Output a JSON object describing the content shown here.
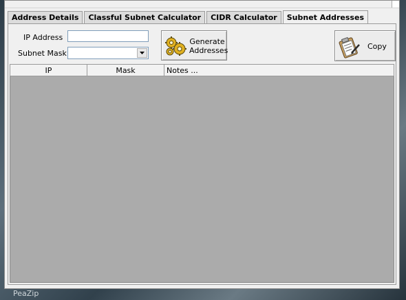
{
  "desktop": {
    "taskbar_text": "PeaZip"
  },
  "tabs": [
    {
      "label": "Address Details",
      "active": false
    },
    {
      "label": "Classful Subnet Calculator",
      "active": false
    },
    {
      "label": "CIDR Calculator",
      "active": false
    },
    {
      "label": "Subnet Addresses",
      "active": true
    }
  ],
  "form": {
    "ip_label": "IP Address",
    "ip_value": "",
    "mask_label": "Subnet Mask",
    "mask_value": ""
  },
  "buttons": {
    "generate_line1": "Generate",
    "generate_line2": "Addresses",
    "copy_label": "Copy"
  },
  "grid": {
    "columns": [
      "IP",
      "Mask",
      "Notes ..."
    ],
    "rows": []
  },
  "colors": {
    "grid_background": "#ababab",
    "window_background": "#f0f0f0"
  },
  "icons": {
    "generate": "gears-icon",
    "copy": "clipboard-icon"
  }
}
